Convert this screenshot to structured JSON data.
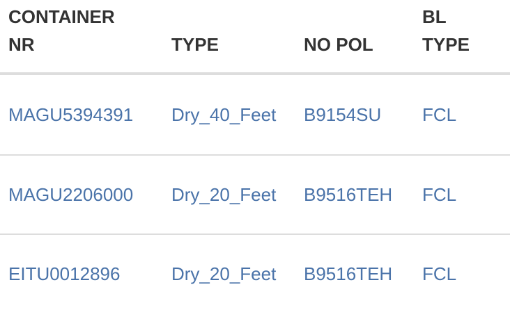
{
  "table": {
    "headers": [
      {
        "line1": "CONTAINER",
        "line2": "NR"
      },
      {
        "line1": "",
        "line2": "TYPE"
      },
      {
        "line1": "",
        "line2": "NO POL"
      },
      {
        "line1": "BL",
        "line2": "TYPE"
      }
    ],
    "rows": [
      {
        "container_nr": "MAGU5394391",
        "type": "Dry_40_Feet",
        "no_pol": "B9154SU",
        "bl_type": "FCL"
      },
      {
        "container_nr": "MAGU2206000",
        "type": "Dry_20_Feet",
        "no_pol": "B9516TEH",
        "bl_type": "FCL"
      },
      {
        "container_nr": "EITU0012896",
        "type": "Dry_20_Feet",
        "no_pol": "B9516TEH",
        "bl_type": "FCL"
      }
    ]
  }
}
